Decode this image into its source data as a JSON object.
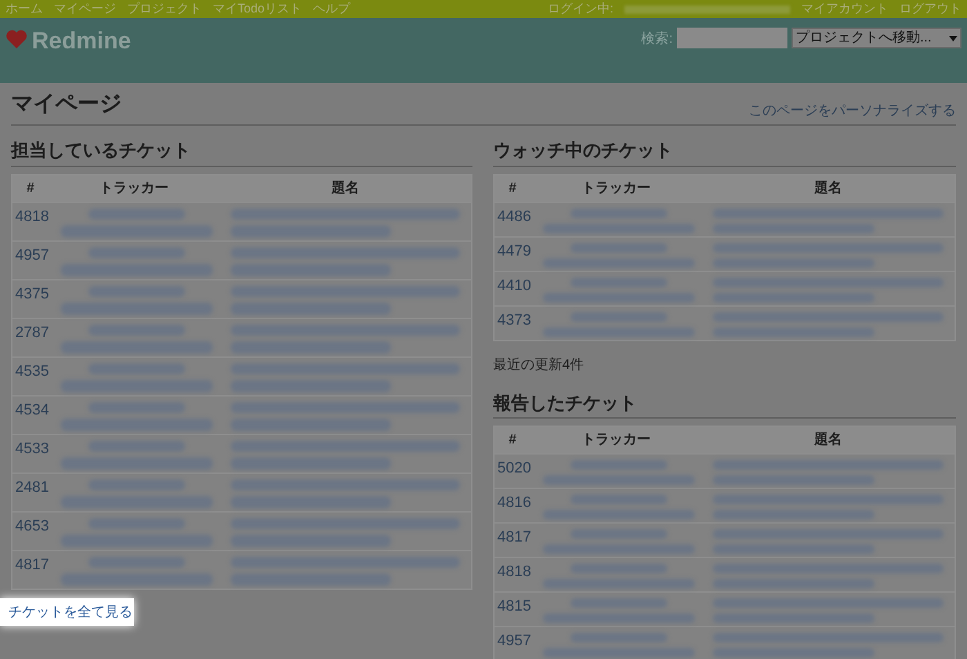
{
  "top_menu": {
    "left": [
      "ホーム",
      "マイページ",
      "プロジェクト",
      "マイTodoリスト",
      "ヘルプ"
    ],
    "logged_in_label": "ログイン中:",
    "right": [
      "マイアカウント",
      "ログアウト"
    ]
  },
  "header": {
    "logo": "Redmine",
    "search_label": "検索:",
    "project_jump": "プロジェクトへ移動..."
  },
  "page": {
    "title": "マイページ",
    "personalize_link": "このページをパーソナライズする"
  },
  "assigned": {
    "title": "担当しているチケット",
    "columns": [
      "#",
      "トラッカー",
      "題名"
    ],
    "rows": [
      {
        "id": "4818"
      },
      {
        "id": "4957"
      },
      {
        "id": "4375"
      },
      {
        "id": "2787"
      },
      {
        "id": "4535"
      },
      {
        "id": "4534"
      },
      {
        "id": "4533"
      },
      {
        "id": "2481"
      },
      {
        "id": "4653"
      },
      {
        "id": "4817"
      }
    ],
    "view_all": "チケットを全て見る"
  },
  "watched": {
    "title": "ウォッチ中のチケット",
    "columns": [
      "#",
      "トラッカー",
      "題名"
    ],
    "rows": [
      {
        "id": "4486"
      },
      {
        "id": "4479"
      },
      {
        "id": "4410"
      },
      {
        "id": "4373"
      }
    ],
    "footer": "最近の更新4件"
  },
  "reported": {
    "title": "報告したチケット",
    "columns": [
      "#",
      "トラッカー",
      "題名"
    ],
    "rows": [
      {
        "id": "5020"
      },
      {
        "id": "4816"
      },
      {
        "id": "4817"
      },
      {
        "id": "4818"
      },
      {
        "id": "4815"
      },
      {
        "id": "4957"
      }
    ]
  }
}
